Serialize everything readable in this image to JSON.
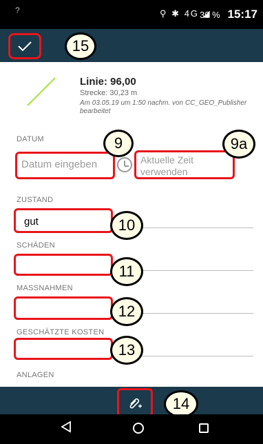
{
  "status": {
    "battery": "30 %",
    "time": "15:17",
    "signal_small": "?",
    "network": "4G"
  },
  "header": {
    "confirm_icon": "check-icon"
  },
  "feature": {
    "title": "Linie: 96,00",
    "length": "Strecke: 30,23 m",
    "edited": "Am 03.05.19 um 1:50 nachm. von CC_GEO_Publisher bearbeitet",
    "line_color": "#a8e23a"
  },
  "form": {
    "date_label": "DATUM",
    "date_placeholder": "Datum eingeben",
    "current_time_button": "Aktuelle Zeit verwenden",
    "condition_label": "ZUSTAND",
    "condition_value": "gut",
    "damage_label": "SCHÄDEN",
    "measures_label": "MASSNAHMEN",
    "cost_label": "GESCHÄTZTE KOSTEN",
    "attachments_label": "ANLAGEN"
  },
  "callouts": {
    "save": "15",
    "date": "9",
    "current_time": "9a",
    "condition": "10",
    "damage": "11",
    "measures": "12",
    "cost": "13",
    "attach": "14"
  },
  "colors": {
    "bar": "#1b3a4b",
    "highlight": "#e8151b",
    "badge_fill": "#fffde6"
  }
}
